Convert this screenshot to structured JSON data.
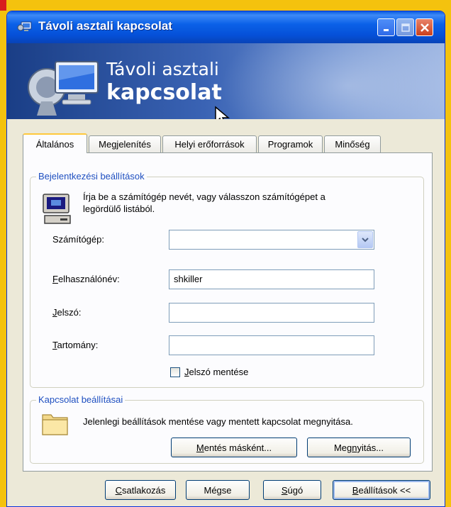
{
  "window": {
    "title": "Távoli asztali kapcsolat",
    "banner_line1": "Távoli asztali",
    "banner_line2": "kapcsolat",
    "accent": "#0550d8"
  },
  "tabs": [
    {
      "label": "Általános",
      "active": true
    },
    {
      "label": "Megjelenítés",
      "active": false
    },
    {
      "label": "Helyi erőforrások",
      "active": false
    },
    {
      "label": "Programok",
      "active": false
    },
    {
      "label": "Minőség",
      "active": false
    }
  ],
  "logon_group": {
    "title": "Bejelentkezési beállítások",
    "description_line1": "Írja be a számítógép nevét, vagy válasszon számítógépet a",
    "description_line2": "legördülő listából.",
    "computer_label": "Számítógép:",
    "computer_value": "",
    "username_label_u": "F",
    "username_label_rest": "elhasználónév:",
    "username_value": "shkiller",
    "password_label_u": "J",
    "password_label_rest": "elszó:",
    "password_value": "",
    "domain_label_u": "T",
    "domain_label_rest": "artomány:",
    "domain_value": "",
    "save_password_label_u": "J",
    "save_password_label_rest": "elszó mentése",
    "save_password_checked": false
  },
  "connection_group": {
    "title": "Kapcsolat beállításai",
    "description": "Jelenlegi beállítások mentése vagy mentett kapcsolat megnyitása.",
    "save_as_u": "M",
    "save_as_rest": "entés másként...",
    "open_pre": "Meg",
    "open_u": "n",
    "open_post": "yitás..."
  },
  "buttons": {
    "connect_u": "C",
    "connect_rest": "satlakozás",
    "cancel": "Mégse",
    "help_u": "S",
    "help_rest": "úgó",
    "options_u": "B",
    "options_rest": "eállítások <<"
  }
}
